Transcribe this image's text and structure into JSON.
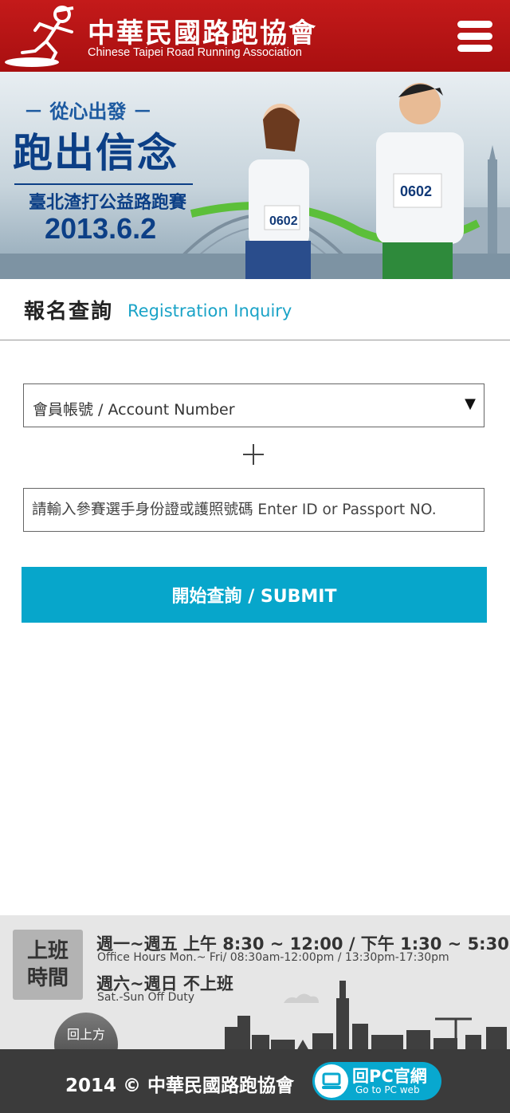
{
  "header": {
    "title_zh": "中華民國路跑協會",
    "title_en": "Chinese Taipei Road Running Association",
    "menu_icon": "hamburger-menu-icon"
  },
  "banner": {
    "tagline": "－ 從心出發 －",
    "headline": "跑出信念",
    "event": "臺北渣打公益路跑賽",
    "date": "2013.6.2",
    "bib_left": "0602",
    "bib_right": "0602"
  },
  "page": {
    "title_zh": "報名查詢",
    "title_en": "Registration Inquiry"
  },
  "form": {
    "lookup_type": "會員帳號 / Account Number",
    "id_placeholder": "請輸入參賽選手身份證或護照號碼 Enter ID or Passport NO.",
    "submit_label": "開始查詢  /  SUBMIT"
  },
  "footer": {
    "badge": "上班時間",
    "badge_line1": "上班",
    "badge_line2": "時間",
    "weekday_zh": "週一~週五 上午 8:30 ~ 12:00 / 下午 1:30 ~ 5:30",
    "weekday_en": "Office Hours  Mon.~ Fri/ 08:30am-12:00pm / 13:30pm-17:30pm",
    "weekend_zh": "週六~週日 不上班",
    "weekend_en": "Sat.-Sun Off Duty",
    "back_to_top": "回上方",
    "copyright": "2014 © 中華民國路跑協會",
    "pc_label": "回PC官網",
    "pc_sub": "Go to PC web"
  },
  "colors": {
    "header_red": "#b8141a",
    "accent_blue": "#07a6cb",
    "footer_dark": "#3b3b3b"
  }
}
